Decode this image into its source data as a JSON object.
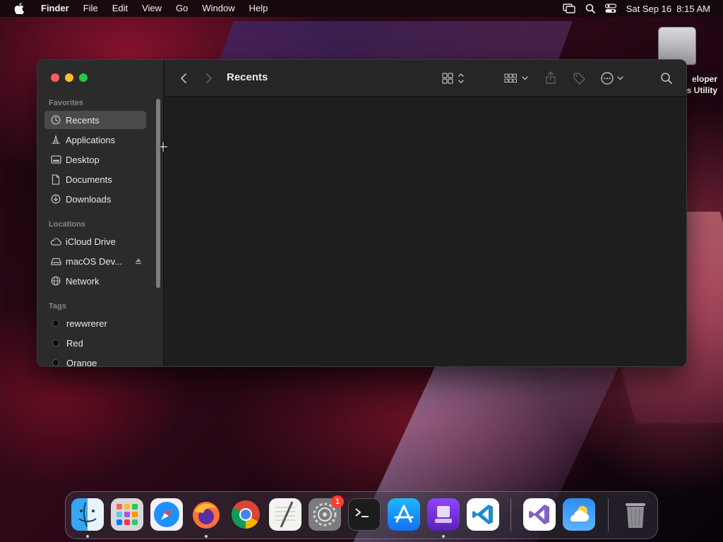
{
  "menubar": {
    "app_name": "Finder",
    "items": [
      "File",
      "Edit",
      "View",
      "Go",
      "Window",
      "Help"
    ],
    "datetime": "Sat Sep 16  8:15 AM",
    "status_icons": [
      "screen-mirroring-icon",
      "spotlight-search-icon",
      "control-center-icon"
    ]
  },
  "desktop": {
    "icon_label_line1": "eloper",
    "icon_label_line2": "s Utility"
  },
  "finder": {
    "title": "Recents",
    "sidebar": {
      "favorites_header": "Favorites",
      "favorites": [
        {
          "label": "Recents",
          "icon": "clock-icon",
          "selected": true
        },
        {
          "label": "Applications",
          "icon": "applications-icon"
        },
        {
          "label": "Desktop",
          "icon": "desktop-icon"
        },
        {
          "label": "Documents",
          "icon": "document-icon"
        },
        {
          "label": "Downloads",
          "icon": "downloads-icon"
        }
      ],
      "locations_header": "Locations",
      "locations": [
        {
          "label": "iCloud Drive",
          "icon": "cloud-icon"
        },
        {
          "label": "macOS Dev...",
          "icon": "drive-icon",
          "ejectable": true
        },
        {
          "label": "Network",
          "icon": "globe-icon"
        }
      ],
      "tags_header": "Tags",
      "tags": [
        {
          "label": "rewwrerer"
        },
        {
          "label": "Red"
        },
        {
          "label": "Orange"
        }
      ]
    }
  },
  "dock": {
    "apps": [
      {
        "name": "Finder",
        "icon": "finder-icon",
        "running": true
      },
      {
        "name": "Launchpad",
        "icon": "launchpad-icon"
      },
      {
        "name": "Safari",
        "icon": "safari-icon"
      },
      {
        "name": "Firefox",
        "icon": "firefox-icon",
        "running": true
      },
      {
        "name": "Chrome",
        "icon": "chrome-icon"
      },
      {
        "name": "TextEdit",
        "icon": "textedit-icon"
      },
      {
        "name": "System Settings",
        "icon": "settings-icon",
        "badge": "1"
      },
      {
        "name": "Terminal",
        "icon": "terminal-icon"
      },
      {
        "name": "App Store",
        "icon": "appstore-icon"
      },
      {
        "name": "Disk Utility",
        "icon": "disk-utility-icon",
        "running": true
      },
      {
        "name": "Visual Studio Code",
        "icon": "vscode-icon"
      },
      {
        "name": "Visual Studio",
        "icon": "visual-studio-icon"
      },
      {
        "name": "Weather",
        "icon": "weather-icon"
      },
      {
        "name": "Trash",
        "icon": "trash-icon"
      }
    ]
  }
}
